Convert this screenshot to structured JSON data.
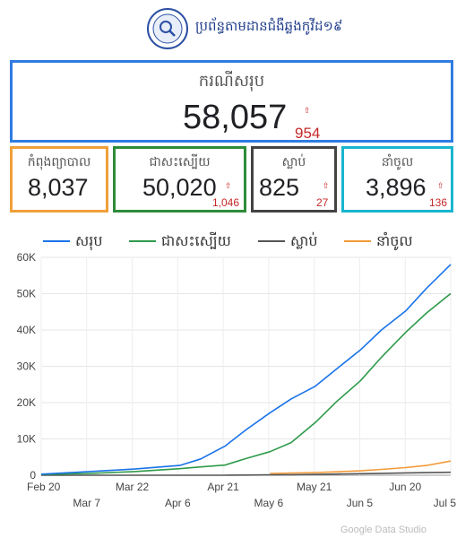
{
  "header": {
    "title": "ប្រព័ន្ធតាមដានជំងឺឆ្លងកូវីដ១៩",
    "logo_icon": "ministry-seal-logo"
  },
  "cards": {
    "total": {
      "label": "ករណីសរុប",
      "value": "58,057",
      "delta": "954"
    },
    "treatment": {
      "label": "កំពុងព្យាបាល",
      "value": "8,037"
    },
    "recovered": {
      "label": "ជាសះស្បើយ",
      "value": "50,020",
      "delta": "1,046"
    },
    "deaths": {
      "label": "ស្លាប់",
      "value": "825",
      "delta": "27"
    },
    "imported": {
      "label": "នាំចូល",
      "value": "3,896",
      "delta": "136"
    }
  },
  "footer": {
    "watermark": "Google Data Studio"
  },
  "chart_data": {
    "type": "line",
    "title": "",
    "xlabel": "",
    "ylabel": "",
    "ylim": [
      0,
      60000
    ],
    "y_ticks": [
      "0",
      "10K",
      "20K",
      "30K",
      "40K",
      "50K",
      "60K"
    ],
    "x_ticks": [
      "Feb 20",
      "Mar 7",
      "Mar 22",
      "Apr 6",
      "Apr 21",
      "May 6",
      "May 21",
      "Jun 5",
      "Jun 20",
      "Jul 5"
    ],
    "legend_position": "top",
    "grid": true,
    "x": [
      "Feb 20",
      "Mar 7",
      "Mar 22",
      "Apr 6",
      "Apr 13",
      "Apr 21",
      "Apr 28",
      "May 6",
      "May 13",
      "May 21",
      "May 28",
      "Jun 5",
      "Jun 12",
      "Jun 20",
      "Jun 27",
      "Jul 5"
    ],
    "series": [
      {
        "name": "សរុប",
        "color": "#1a73e8",
        "values": [
          300,
          1000,
          1700,
          2700,
          4500,
          8000,
          12500,
          17200,
          21000,
          24500,
          29200,
          34500,
          40000,
          45200,
          51500,
          58057
        ]
      },
      {
        "name": "ជាសះស្បើយ",
        "color": "#2e9a4a",
        "values": [
          200,
          500,
          1000,
          1800,
          2300,
          2800,
          4600,
          6500,
          9000,
          14500,
          20200,
          26000,
          32500,
          39300,
          44700,
          50020
        ]
      },
      {
        "name": "ស្លាប់",
        "color": "#555555",
        "values": [
          0,
          0,
          0,
          0,
          0,
          10,
          40,
          90,
          150,
          230,
          330,
          430,
          530,
          630,
          720,
          825
        ]
      },
      {
        "name": "នាំចូល",
        "color": "#f29a38",
        "values": [
          0,
          0,
          0,
          0,
          0,
          0,
          0,
          500,
          620,
          750,
          950,
          1200,
          1600,
          2100,
          2700,
          3896
        ]
      }
    ]
  }
}
